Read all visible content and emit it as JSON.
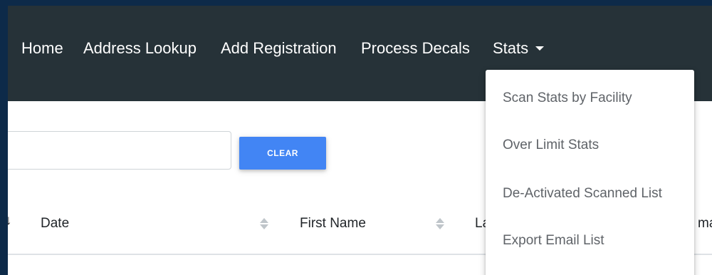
{
  "navbar": {
    "links": [
      "Home",
      "Address Lookup",
      "Add Registration",
      "Process Decals"
    ],
    "stats_label": "Stats",
    "background": "#263238"
  },
  "search": {
    "value": "",
    "placeholder": "",
    "clear_label": "CLEAR",
    "clear_color": "#4285f4"
  },
  "table": {
    "columns": [
      "Date",
      "First Name",
      "La",
      "ma"
    ]
  },
  "stats_menu": {
    "items": [
      "Scan Stats by Facility",
      "Over Limit Stats",
      "De-Activated Scanned List",
      "Export Email List"
    ]
  }
}
